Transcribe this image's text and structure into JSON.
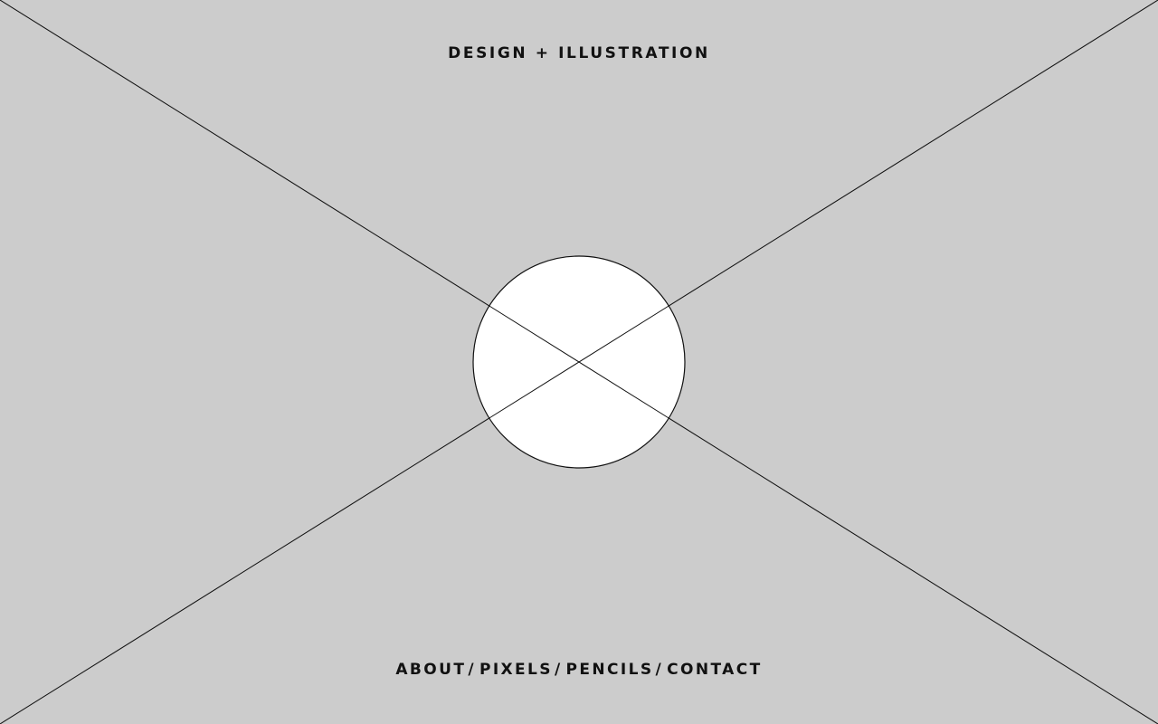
{
  "colors": {
    "background": "#cccccc",
    "lines": "#111111",
    "circle_fill": "#ffffff",
    "text": "#111111"
  },
  "header": {
    "tagline": "DESIGN + ILLUSTRATION"
  },
  "nav": {
    "separator": "/",
    "items": [
      {
        "label": "ABOUT"
      },
      {
        "label": "PIXELS"
      },
      {
        "label": "PENCILS"
      },
      {
        "label": "CONTACT"
      }
    ]
  }
}
